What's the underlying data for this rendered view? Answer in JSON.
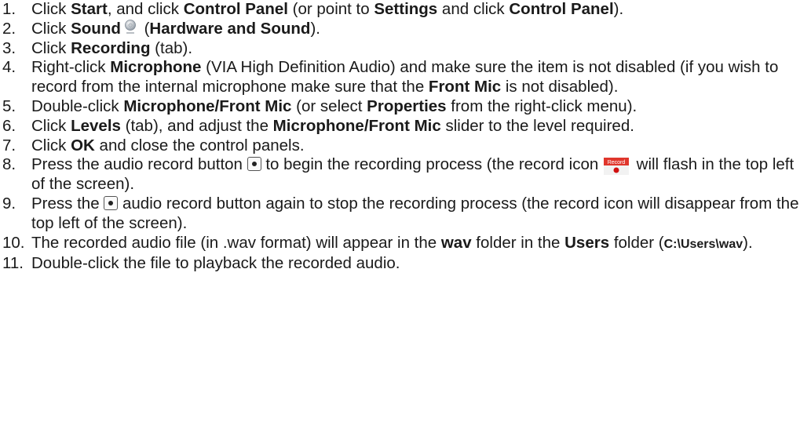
{
  "steps": [
    {
      "num": "1.",
      "parts": [
        {
          "t": "Click "
        },
        {
          "b": "Start"
        },
        {
          "t": ", and click "
        },
        {
          "b": "Control Panel"
        },
        {
          "t": " (or point to "
        },
        {
          "b": "Settings"
        },
        {
          "t": " and click "
        },
        {
          "b": "Control Panel"
        },
        {
          "t": ")."
        }
      ]
    },
    {
      "num": "2.",
      "parts": [
        {
          "t": "Click "
        },
        {
          "b": "Sound"
        },
        {
          "icon": "sound-icon"
        },
        {
          "t": " ("
        },
        {
          "b": "Hardware and Sound"
        },
        {
          "t": ")."
        }
      ]
    },
    {
      "num": "3.",
      "parts": [
        {
          "t": "Click "
        },
        {
          "b": "Recording"
        },
        {
          "t": " (tab)."
        }
      ]
    },
    {
      "num": "4.",
      "parts": [
        {
          "t": "Right-click "
        },
        {
          "b": "Microphone"
        },
        {
          "t": " (VIA High Definition Audio) and make sure the item is not disabled (if you wish to record from the internal microphone make sure that the "
        },
        {
          "b": "Front Mic"
        },
        {
          "t": " is not disabled)."
        }
      ]
    },
    {
      "num": "5.",
      "parts": [
        {
          "t": "Double-click "
        },
        {
          "b": "Microphone/Front Mic"
        },
        {
          "t": " (or select "
        },
        {
          "b": "Properties"
        },
        {
          "t": " from the right-click menu)."
        }
      ]
    },
    {
      "num": "6.",
      "parts": [
        {
          "t": "Click "
        },
        {
          "b": "Levels"
        },
        {
          "t": " (tab), and adjust the "
        },
        {
          "b": "Microphone/Front Mic"
        },
        {
          "t": " slider to the level required."
        }
      ]
    },
    {
      "num": "7.",
      "parts": [
        {
          "t": "Click "
        },
        {
          "b": "OK"
        },
        {
          "t": " and close the control panels."
        }
      ]
    },
    {
      "num": "8.",
      "parts": [
        {
          "t": "Press the audio record button "
        },
        {
          "icon": "record-button-icon"
        },
        {
          "t": " to begin the recording process (the record icon "
        },
        {
          "icon": "record-badge-icon"
        },
        {
          "t": " will flash in the top left of the screen)."
        }
      ]
    },
    {
      "num": "9.",
      "parts": [
        {
          "t": "Press the "
        },
        {
          "icon": "record-button-icon"
        },
        {
          "t": " audio record button again to stop the recording process (the record icon will disappear from the top left of the screen)."
        }
      ]
    },
    {
      "num": "10.",
      "parts": [
        {
          "t": "The recorded audio file (in .wav format) will appear in the "
        },
        {
          "b": "wav"
        },
        {
          "t": " folder in the "
        },
        {
          "b": "Users"
        },
        {
          "t": " folder ("
        },
        {
          "m": "C:\\Users\\wav"
        },
        {
          "t": ")."
        }
      ]
    },
    {
      "num": "11.",
      "parts": [
        {
          "t": "Double-click the file to playback the recorded audio."
        }
      ]
    }
  ],
  "icons": {
    "record_badge_label": "Record",
    "record_badge_color": "#e0362c",
    "record_dot_color": "#d01010"
  }
}
